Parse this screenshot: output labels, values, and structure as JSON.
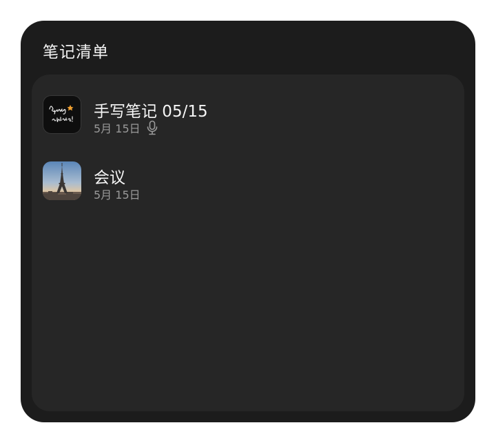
{
  "widget": {
    "title": "笔记清单",
    "notes": [
      {
        "title": "手写笔记 05/15",
        "date": "5月 15日",
        "thumbnail_icon": "handwriting-thumbnail",
        "has_voice_recording": true,
        "voice_icon": "microphone-icon"
      },
      {
        "title": "会议",
        "date": "5月 15日",
        "thumbnail_icon": "eiffel-tower-photo-thumbnail",
        "has_voice_recording": false
      }
    ]
  },
  "colors": {
    "page_background": "#ffffff",
    "widget_background": "#1c1c1c",
    "list_background": "#262626",
    "title_text": "#f5f5f5",
    "secondary_text": "#9a9a9a"
  }
}
